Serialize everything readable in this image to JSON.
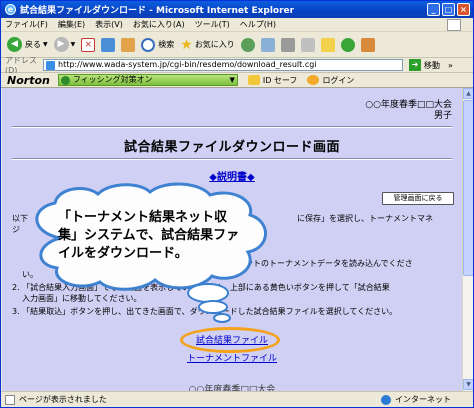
{
  "window": {
    "title": "試合結果ファイルダウンロード - Microsoft Internet Explorer",
    "icon": "ie-icon",
    "controls": {
      "minimize": "_",
      "maximize": "□",
      "close": "×"
    }
  },
  "menu": [
    "ファイル(F)",
    "編集(E)",
    "表示(V)",
    "お気に入り(A)",
    "ツール(T)",
    "ヘルプ(H)"
  ],
  "toolbar": {
    "back_label": "戻る",
    "search_label": "検索",
    "favorites_label": "お気に入り"
  },
  "address": {
    "label": "アドレス(D)",
    "url": "http://www.wada-system.jp/cgi-bin/resdemo/download_result.cgi",
    "go_label": "移動",
    "links_label": "»"
  },
  "norton": {
    "logo": "Norton",
    "phishing": "フィッシング対策オン",
    "id_safe": "ID セーフ",
    "login": "ログイン"
  },
  "page": {
    "tournament_line1": "○○年度春季□□大会",
    "tournament_line2": "男子",
    "title": "試合結果ファイルダウンロード画面",
    "manual_link": "◆説明書◆",
    "admin_button": "管理画面に戻る",
    "line_a_left": "以下",
    "line_a_right": "に保存」を選択し、トーナメントマネ",
    "line_b_left": "ジ",
    "line_c_right": "メントのトーナメントデータを読み込んでくださ",
    "line_c_tail": "い。",
    "step2": "2. 「試合結果入力画面」でない画面を表示している場合は、上部にある黄色いボタンを押して「試合結果",
    "step2b": "入力画面」に移動してください。",
    "step3": "3. 「結果取込」ボタンを押し、出てきた画面で、ダウンロードした試合結果ファイルを選択してください。",
    "file_link_1": "試合結果ファイル",
    "file_link_2": "トーナメントファイル",
    "cut_text": "○○年度春季□□大会"
  },
  "callout": {
    "text": "「トーナメント結果ネット収集」システムで、試合結果ファイルをダウンロード。"
  },
  "status": {
    "text": "ページが表示されました",
    "zone": "インターネット"
  }
}
